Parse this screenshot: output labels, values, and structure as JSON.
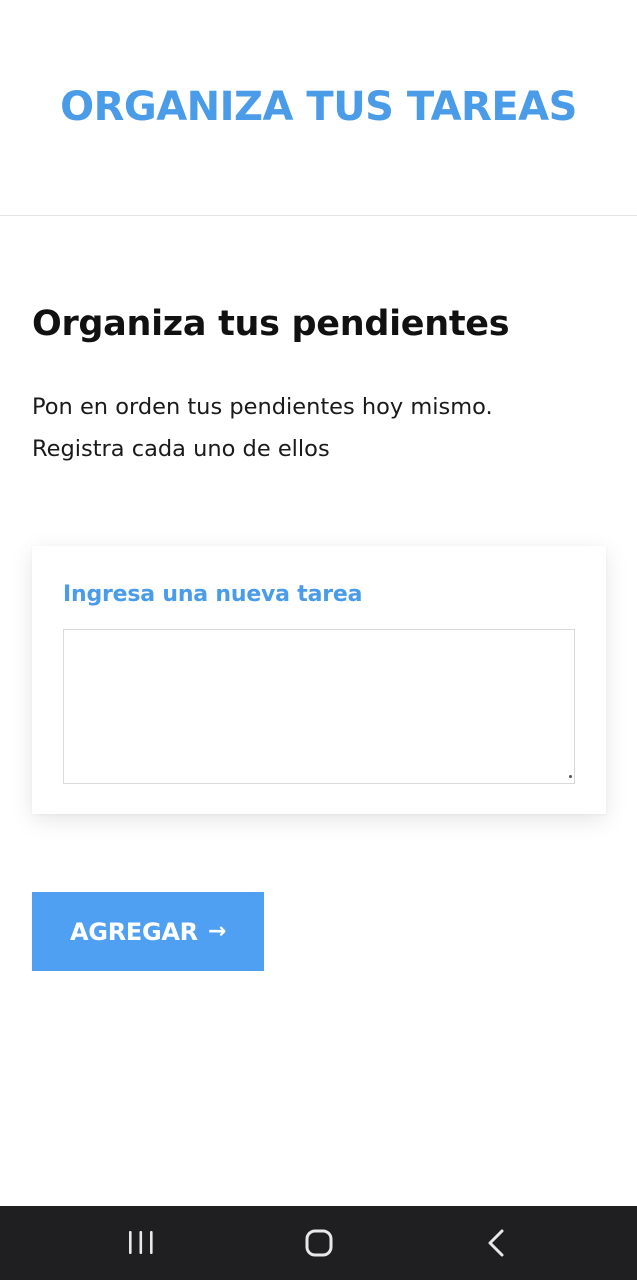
{
  "header": {
    "title": "ORGANIZA TUS TAREAS"
  },
  "main": {
    "title": "Organiza tus pendientes",
    "description_line1": "Pon en orden tus pendientes hoy mismo.",
    "description_line2": "Registra cada uno de ellos"
  },
  "form": {
    "label": "Ingresa una nueva tarea",
    "value": "",
    "submit_label": "AGREGAR",
    "submit_icon": "arrow-right-icon",
    "submit_arrow": "→"
  },
  "system_nav": {
    "recent_icon": "recent-apps-icon",
    "home_icon": "home-icon",
    "back_icon": "back-icon"
  },
  "colors": {
    "accent": "#4a9be8",
    "button": "#4f9ff3",
    "navbar": "#1f1f21"
  }
}
